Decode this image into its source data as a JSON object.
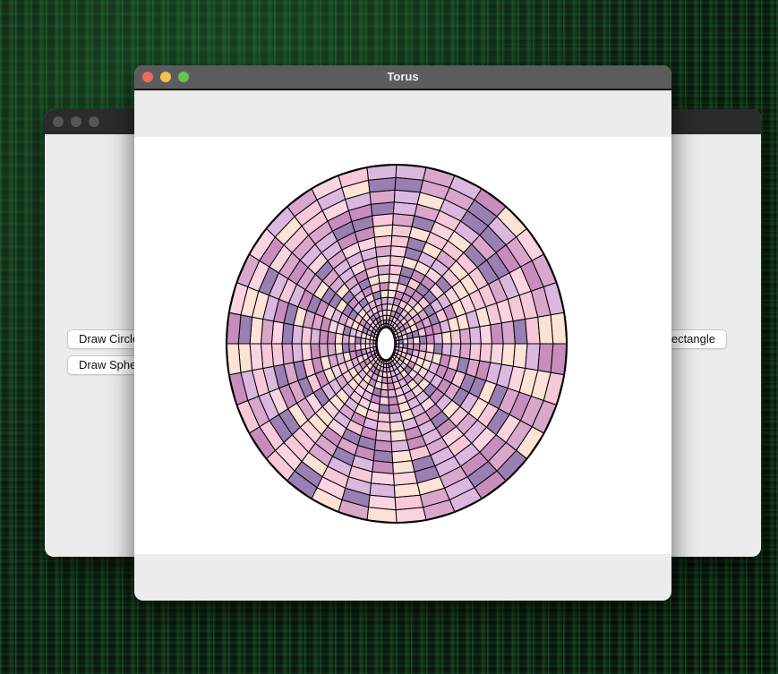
{
  "wallpaper": {
    "theme": "matrix-green",
    "accent": "#3fa45a"
  },
  "back_window": {
    "buttons": {
      "draw_circle": "Draw Circle",
      "draw_sphere": "Draw Sphere",
      "draw_rectangle": "Draw Rectangle"
    }
  },
  "front_window": {
    "title": "Torus",
    "traffic_lights": {
      "close": "#ed6a5e",
      "minimize": "#f5bf4f",
      "zoom": "#61c554"
    },
    "canvas": {
      "shape": "torus",
      "patch_colors": [
        "#dcb8e0",
        "#f6c8d8",
        "#ffe2d6",
        "#c88cbd",
        "#9a7fb2",
        "#d9a6cc",
        "#fbd4e2"
      ],
      "outline_color": "#000000"
    }
  }
}
